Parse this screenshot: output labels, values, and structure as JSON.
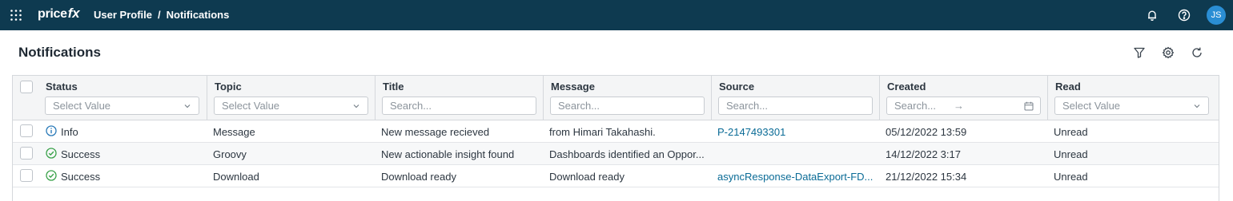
{
  "topbar": {
    "logo_main": "price",
    "logo_accent": "fx",
    "breadcrumb": [
      "User Profile",
      "Notifications"
    ],
    "breadcrumb_separator": "/",
    "avatar_initials": "JS",
    "background": "#0e3a50",
    "avatar_color": "#2a8ed4",
    "icons": [
      "apps-grid-icon",
      "bell-icon",
      "help-icon"
    ]
  },
  "page": {
    "title": "Notifications",
    "actions": [
      "filter-icon",
      "settings-gear-icon",
      "refresh-icon"
    ]
  },
  "table": {
    "columns": [
      {
        "label": "Status",
        "filter_type": "select",
        "filter_placeholder": "Select Value"
      },
      {
        "label": "Topic",
        "filter_type": "select",
        "filter_placeholder": "Select Value"
      },
      {
        "label": "Title",
        "filter_type": "text",
        "filter_placeholder": "Search..."
      },
      {
        "label": "Message",
        "filter_type": "text",
        "filter_placeholder": "Search..."
      },
      {
        "label": "Source",
        "filter_type": "text",
        "filter_placeholder": "Search..."
      },
      {
        "label": "Created",
        "filter_type": "daterange",
        "filter_placeholder": "Search...",
        "range_arrow": "→"
      },
      {
        "label": "Read",
        "filter_type": "select",
        "filter_placeholder": "Select Value"
      }
    ],
    "rows": [
      {
        "status": "Info",
        "status_icon": "info-circle-icon",
        "topic": "Message",
        "title": "New message recieved",
        "message": "from Himari Takahashi.",
        "source": "P-2147493301",
        "created": "05/12/2022 13:59",
        "read": "Unread"
      },
      {
        "status": "Success",
        "status_icon": "check-circle-icon",
        "topic": "Groovy",
        "title": "New actionable insight found",
        "message": "Dashboards identified an Oppor...",
        "source": "",
        "created": "14/12/2022 3:17",
        "read": "Unread"
      },
      {
        "status": "Success",
        "status_icon": "check-circle-icon",
        "topic": "Download",
        "title": "Download ready",
        "message": "Download ready",
        "source": "asyncResponse-DataExport-FD...",
        "created": "21/12/2022 15:34",
        "read": "Unread"
      }
    ],
    "colors": {
      "info": "#2a7ab8",
      "success": "#3aa24a",
      "link": "#0a6b96"
    }
  }
}
